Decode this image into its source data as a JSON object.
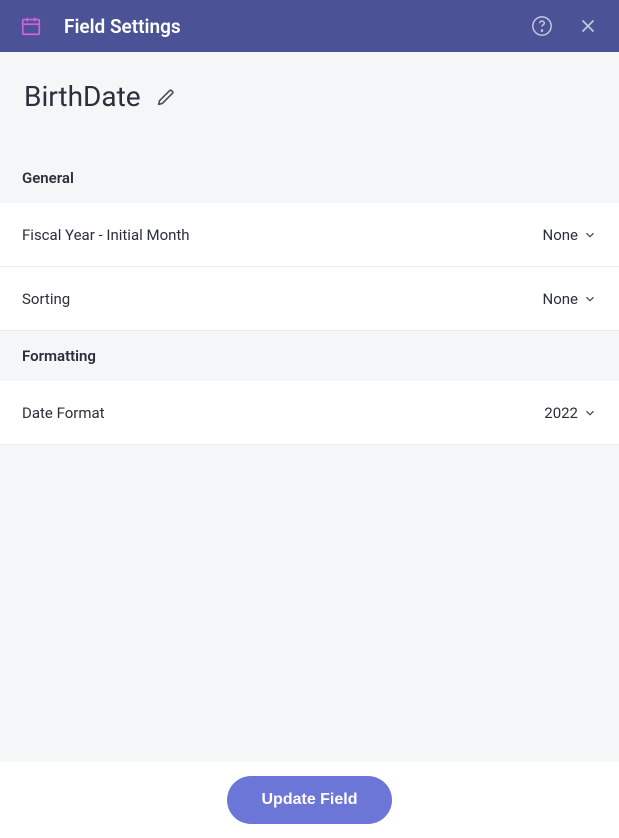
{
  "header": {
    "title": "Field Settings"
  },
  "field": {
    "name": "BirthDate"
  },
  "sections": {
    "general": {
      "label": "General",
      "fiscal_year": {
        "label": "Fiscal Year - Initial Month",
        "value": "None"
      },
      "sorting": {
        "label": "Sorting",
        "value": "None"
      }
    },
    "formatting": {
      "label": "Formatting",
      "date_format": {
        "label": "Date Format",
        "value": "2022"
      }
    }
  },
  "footer": {
    "update_label": "Update Field"
  }
}
